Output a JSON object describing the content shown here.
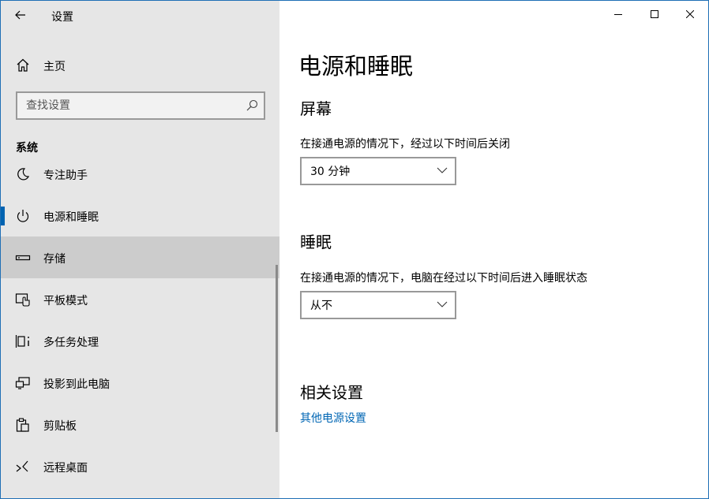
{
  "app": {
    "title": "设置"
  },
  "home": {
    "label": "主页"
  },
  "search": {
    "placeholder": "查找设置"
  },
  "sidebar": {
    "section": "系统",
    "items": [
      {
        "label": "专注助手",
        "icon": "moon-icon"
      },
      {
        "label": "电源和睡眠",
        "icon": "power-icon",
        "active": true
      },
      {
        "label": "存储",
        "icon": "storage-icon",
        "hovered": true
      },
      {
        "label": "平板模式",
        "icon": "tablet-mode-icon"
      },
      {
        "label": "多任务处理",
        "icon": "multitasking-icon"
      },
      {
        "label": "投影到此电脑",
        "icon": "project-icon"
      },
      {
        "label": "剪贴板",
        "icon": "clipboard-icon"
      },
      {
        "label": "远程桌面",
        "icon": "remote-desktop-icon"
      }
    ]
  },
  "main": {
    "title": "电源和睡眠",
    "screen": {
      "heading": "屏幕",
      "description": "在接通电源的情况下，经过以下时间后关闭",
      "value": "30 分钟"
    },
    "sleep": {
      "heading": "睡眠",
      "description": "在接通电源的情况下，电脑在经过以下时间后进入睡眠状态",
      "value": "从不"
    },
    "related": {
      "heading": "相关设置",
      "link": "其他电源设置"
    }
  },
  "colors": {
    "accent": "#0063b1",
    "link": "#0066b4",
    "sidebar_bg": "#e6e6e6",
    "selected_bg": "#cccccc"
  }
}
